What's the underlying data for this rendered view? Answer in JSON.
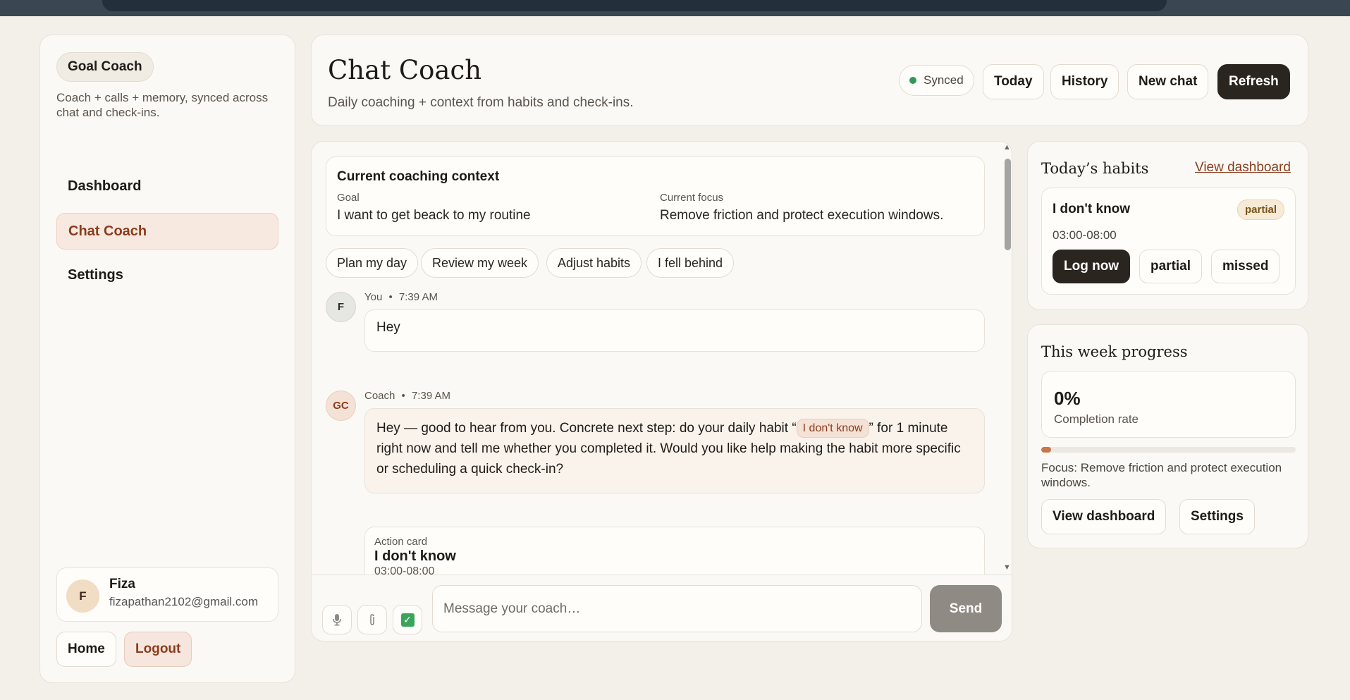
{
  "sidebar": {
    "brand": "Goal Coach",
    "description": "Coach + calls + memory, synced across chat and check-ins.",
    "nav": [
      "Dashboard",
      "Chat Coach",
      "Settings"
    ],
    "user": {
      "initial": "F",
      "name": "Fiza",
      "email": "fizapathan2102@gmail.com"
    },
    "home_label": "Home",
    "logout_label": "Logout"
  },
  "header": {
    "title": "Chat Coach",
    "subtitle": "Daily coaching + context from habits and check-ins.",
    "sync_status": "Synced",
    "buttons": {
      "today": "Today",
      "history": "History",
      "new_chat": "New chat",
      "refresh": "Refresh"
    }
  },
  "context": {
    "title": "Current coaching context",
    "goal_label": "Goal",
    "goal_value": "I want to get beack to my routine",
    "focus_label": "Current focus",
    "focus_value": "Remove friction and protect execution windows."
  },
  "quick_prompts": [
    "Plan my day",
    "Review my week",
    "Adjust habits",
    "I fell behind"
  ],
  "messages": [
    {
      "avatar": "F",
      "author": "You",
      "separator": "•",
      "time": "7:39 AM",
      "text": "Hey"
    },
    {
      "avatar": "GC",
      "author": "Coach",
      "separator": "•",
      "time": "7:39 AM",
      "text_before": "Hey — good to hear from you. Concrete next step: do your daily habit “",
      "habit_tag": "I don't know",
      "text_after": "” for 1 minute right now and tell me whether you completed it. Would you like help making the habit more specific or scheduling a quick check-in?"
    }
  ],
  "action_card": {
    "label": "Action card",
    "title": "I don't know",
    "time": "03:00-08:00"
  },
  "composer": {
    "placeholder": "Message your coach…",
    "send_label": "Send",
    "check_glyph": "✓"
  },
  "habits_card": {
    "title": "Today’s habits",
    "link": "View dashboard",
    "habit": {
      "name": "I don't know",
      "status": "partial",
      "time": "03:00-08:00",
      "buttons": [
        "Log now",
        "partial",
        "missed"
      ]
    }
  },
  "progress_card": {
    "title": "This week progress",
    "value_text": "0%",
    "completion_rate": 0,
    "label": "Completion rate",
    "focus": "Focus: Remove friction and protect execution windows.",
    "buttons": [
      "View dashboard",
      "Settings"
    ]
  },
  "colors": {
    "accent": "#8a3d1e",
    "dark_button": "#2b2520",
    "synced_dot": "#2f9a5a",
    "progress_fill": "#c8764a"
  },
  "icons": {
    "microphone": "microphone-icon",
    "attachment": "paperclip-icon",
    "checkin": "checkbox-icon"
  }
}
